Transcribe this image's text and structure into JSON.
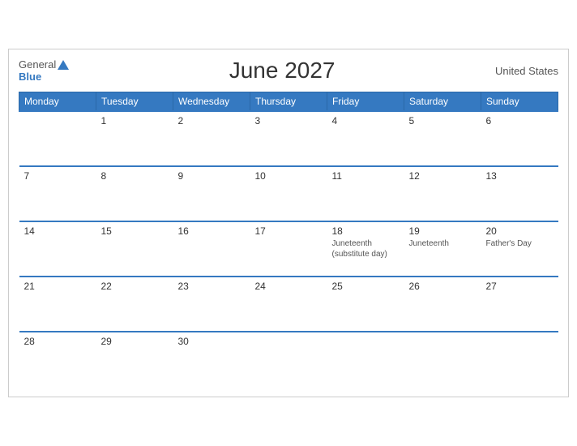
{
  "header": {
    "logo_general": "General",
    "logo_blue": "Blue",
    "title": "June 2027",
    "country": "United States"
  },
  "columns": [
    "Monday",
    "Tuesday",
    "Wednesday",
    "Thursday",
    "Friday",
    "Saturday",
    "Sunday"
  ],
  "weeks": [
    [
      {
        "day": "",
        "events": [],
        "empty": true
      },
      {
        "day": "1",
        "events": [],
        "empty": false
      },
      {
        "day": "2",
        "events": [],
        "empty": false
      },
      {
        "day": "3",
        "events": [],
        "empty": false
      },
      {
        "day": "4",
        "events": [],
        "empty": false
      },
      {
        "day": "5",
        "events": [],
        "empty": false
      },
      {
        "day": "6",
        "events": [],
        "empty": false
      }
    ],
    [
      {
        "day": "7",
        "events": [],
        "empty": false
      },
      {
        "day": "8",
        "events": [],
        "empty": false
      },
      {
        "day": "9",
        "events": [],
        "empty": false
      },
      {
        "day": "10",
        "events": [],
        "empty": false
      },
      {
        "day": "11",
        "events": [],
        "empty": false
      },
      {
        "day": "12",
        "events": [],
        "empty": false
      },
      {
        "day": "13",
        "events": [],
        "empty": false
      }
    ],
    [
      {
        "day": "14",
        "events": [],
        "empty": false
      },
      {
        "day": "15",
        "events": [],
        "empty": false
      },
      {
        "day": "16",
        "events": [],
        "empty": false
      },
      {
        "day": "17",
        "events": [],
        "empty": false
      },
      {
        "day": "18",
        "events": [
          "Juneteenth",
          "(substitute day)"
        ],
        "empty": false
      },
      {
        "day": "19",
        "events": [
          "Juneteenth"
        ],
        "empty": false
      },
      {
        "day": "20",
        "events": [
          "Father's Day"
        ],
        "empty": false
      }
    ],
    [
      {
        "day": "21",
        "events": [],
        "empty": false
      },
      {
        "day": "22",
        "events": [],
        "empty": false
      },
      {
        "day": "23",
        "events": [],
        "empty": false
      },
      {
        "day": "24",
        "events": [],
        "empty": false
      },
      {
        "day": "25",
        "events": [],
        "empty": false
      },
      {
        "day": "26",
        "events": [],
        "empty": false
      },
      {
        "day": "27",
        "events": [],
        "empty": false
      }
    ],
    [
      {
        "day": "28",
        "events": [],
        "empty": false
      },
      {
        "day": "29",
        "events": [],
        "empty": false
      },
      {
        "day": "30",
        "events": [],
        "empty": false
      },
      {
        "day": "",
        "events": [],
        "empty": true
      },
      {
        "day": "",
        "events": [],
        "empty": true
      },
      {
        "day": "",
        "events": [],
        "empty": true
      },
      {
        "day": "",
        "events": [],
        "empty": true
      }
    ]
  ]
}
